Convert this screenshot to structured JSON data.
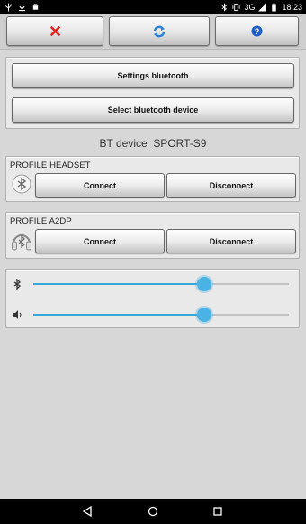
{
  "status_bar": {
    "left_icons": [
      "usb-icon",
      "download-icon",
      "android-debug-icon"
    ],
    "right_icons": [
      "bluetooth-icon",
      "vibrate-icon",
      "signal-icon",
      "battery-icon"
    ],
    "network": "3G",
    "time": "18:23"
  },
  "toolbar": {
    "close_icon": "close-x-icon",
    "refresh_icon": "sync-icon",
    "help_icon": "help-icon"
  },
  "bluetooth": {
    "settings_label": "Settings bluetooth",
    "select_label": "Select bluetooth device"
  },
  "device": {
    "label": "BT device  SPORT-S9"
  },
  "profile_headset": {
    "title": "PROFILE HEADSET",
    "connect_label": "Connect",
    "disconnect_label": "Disconnect"
  },
  "profile_a2dp": {
    "title": "PROFILE A2DP",
    "connect_label": "Connect",
    "disconnect_label": "Disconnect"
  },
  "sliders": {
    "bluetooth_level": 0.67,
    "volume_level": 0.67
  },
  "colors": {
    "accent": "#35a8da",
    "close": "#e02020",
    "refresh": "#2a7fd6",
    "help": "#1f5fc4"
  }
}
